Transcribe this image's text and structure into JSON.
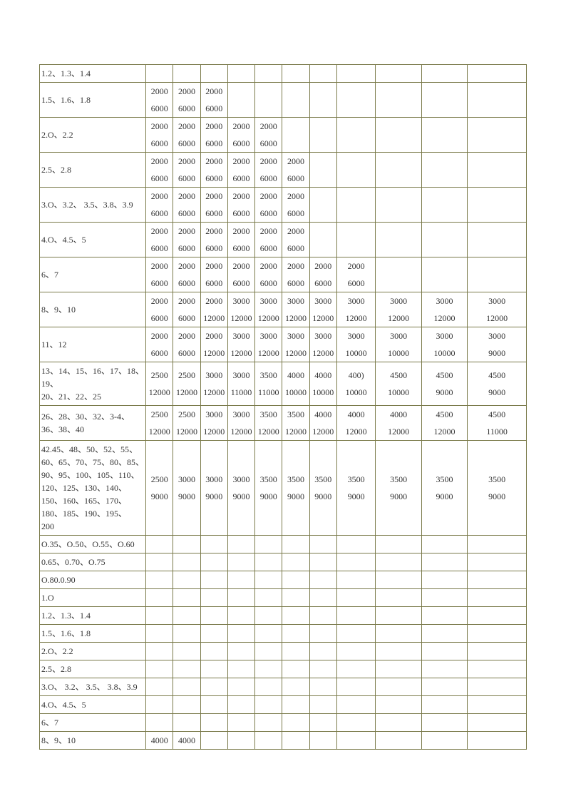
{
  "rows": [
    {
      "label": "1.2、1.3、1.4",
      "top": [
        "",
        "",
        "",
        "",
        "",
        "",
        "",
        "",
        "",
        "",
        ""
      ],
      "bot": [
        "",
        "",
        "",
        "",
        "",
        "",
        "",
        "",
        "",
        "",
        ""
      ],
      "single": true
    },
    {
      "label": "1.5、1.6、1.8",
      "top": [
        "2000",
        "2000",
        "2000",
        "",
        "",
        "",
        "",
        "",
        "",
        "",
        ""
      ],
      "bot": [
        "6000",
        "6000",
        "6000",
        "",
        "",
        "",
        "",
        "",
        "",
        "",
        ""
      ]
    },
    {
      "label": "2.O、2.2",
      "top": [
        "2000",
        "2000",
        "2000",
        "2000",
        "2000",
        "",
        "",
        "",
        "",
        "",
        ""
      ],
      "bot": [
        "6000",
        "6000",
        "6000",
        "6000",
        "6000",
        "",
        "",
        "",
        "",
        "",
        ""
      ]
    },
    {
      "label": "2.5、2.8",
      "top": [
        "2000",
        "2000",
        "2000",
        "2000",
        "2000",
        "2000",
        "",
        "",
        "",
        "",
        ""
      ],
      "bot": [
        "6000",
        "6000",
        "6000",
        "6000",
        "6000",
        "6000",
        "",
        "",
        "",
        "",
        ""
      ]
    },
    {
      "label": "3.O、3.2、 3.5、3.8、3.9",
      "top": [
        "2000",
        "2000",
        "2000",
        "2000",
        "2000",
        "2000",
        "",
        "",
        "",
        "",
        ""
      ],
      "bot": [
        "6000",
        "6000",
        "6000",
        "6000",
        "6000",
        "6000",
        "",
        "",
        "",
        "",
        ""
      ]
    },
    {
      "label": "4.O、4.5、5",
      "top": [
        "2000",
        "2000",
        "2000",
        "2000",
        "2000",
        "2000",
        "",
        "",
        "",
        "",
        ""
      ],
      "bot": [
        "6000",
        "6000",
        "6000",
        "6000",
        "6000",
        "6000",
        "",
        "",
        "",
        "",
        ""
      ]
    },
    {
      "label": "6、7",
      "top": [
        "2000",
        "2000",
        "2000",
        "2000",
        "2000",
        "2000",
        "2000",
        "2000",
        "",
        "",
        ""
      ],
      "bot": [
        "6000",
        "6000",
        "6000",
        "6000",
        "6000",
        "6000",
        "6000",
        "6000",
        "",
        "",
        ""
      ]
    },
    {
      "label": "8、9、10",
      "top": [
        "2000",
        "2000",
        "2000",
        "3000",
        "3000",
        "3000",
        "3000",
        "3000",
        "3000",
        "3000",
        "3000"
      ],
      "bot": [
        "6000",
        "6000",
        "12000",
        "12000",
        "12000",
        "12000",
        "12000",
        "12000",
        "12000",
        "12000",
        "12000"
      ]
    },
    {
      "label": "11、12",
      "top": [
        "2000",
        "2000",
        "2000",
        "3000",
        "3000",
        "3000",
        "3000",
        "3000",
        "3000",
        "3000",
        "3000"
      ],
      "bot": [
        "6000",
        "6000",
        "12000",
        "12000",
        "12000",
        "12000",
        "12000",
        "10000",
        "10000",
        "10000",
        "9000"
      ]
    },
    {
      "label": "13、14、15、16、17、18、19、\n20、21、22、25",
      "top": [
        "2500",
        "2500",
        "3000",
        "3000",
        "3500",
        "4000",
        "4000",
        "400)",
        "4500",
        "4500",
        "4500"
      ],
      "bot": [
        "12000",
        "12000",
        "12000",
        "11000",
        "11000",
        "10000",
        "10000",
        "10000",
        "10000",
        "9000",
        "9000"
      ]
    },
    {
      "label": "26、28、30、32、3-4、36、38、40",
      "top": [
        "2500",
        "2500",
        "3000",
        "3000",
        "3500",
        "3500",
        "4000",
        "4000",
        "4000",
        "4500",
        "4500"
      ],
      "bot": [
        "12000",
        "12000",
        "12000",
        "12000",
        "12000",
        "12000",
        "12000",
        "12000",
        "12000",
        "12000",
        "11000"
      ]
    },
    {
      "label": "42.45、48、50、52、55、60、65、70、75、80、85、90、95、100、105、110、120、125、130、140、150、160、165、170、180、185、190、195、\n200",
      "top": [
        "2500",
        "3000",
        "3000",
        "3000",
        "3500",
        "3500",
        "3500",
        "3500",
        "3500",
        "3500",
        "3500"
      ],
      "bot": [
        "9000",
        "9000",
        "9000",
        "9000",
        "9000",
        "9000",
        "9000",
        "9000",
        "9000",
        "9000",
        "9000"
      ]
    },
    {
      "label": "O.35、O.50、O.55、O.60",
      "top": [
        "",
        "",
        "",
        "",
        "",
        "",
        "",
        "",
        "",
        "",
        ""
      ],
      "bot": [
        "",
        "",
        "",
        "",
        "",
        "",
        "",
        "",
        "",
        "",
        ""
      ],
      "single": true
    },
    {
      "label": "0.65、0.70、O.75",
      "top": [
        "",
        "",
        "",
        "",
        "",
        "",
        "",
        "",
        "",
        "",
        ""
      ],
      "bot": [
        "",
        "",
        "",
        "",
        "",
        "",
        "",
        "",
        "",
        "",
        ""
      ],
      "single": true
    },
    {
      "label": "O.80.0.90",
      "top": [
        "",
        "",
        "",
        "",
        "",
        "",
        "",
        "",
        "",
        "",
        ""
      ],
      "bot": [
        "",
        "",
        "",
        "",
        "",
        "",
        "",
        "",
        "",
        "",
        ""
      ],
      "single": true
    },
    {
      "label": "1.O",
      "top": [
        "",
        "",
        "",
        "",
        "",
        "",
        "",
        "",
        "",
        "",
        ""
      ],
      "bot": [
        "",
        "",
        "",
        "",
        "",
        "",
        "",
        "",
        "",
        "",
        ""
      ],
      "single": true
    },
    {
      "label": "1.2、1.3、1.4",
      "top": [
        "",
        "",
        "",
        "",
        "",
        "",
        "",
        "",
        "",
        "",
        ""
      ],
      "bot": [
        "",
        "",
        "",
        "",
        "",
        "",
        "",
        "",
        "",
        "",
        ""
      ],
      "single": true
    },
    {
      "label": "1.5、1.6、1.8",
      "top": [
        "",
        "",
        "",
        "",
        "",
        "",
        "",
        "",
        "",
        "",
        ""
      ],
      "bot": [
        "",
        "",
        "",
        "",
        "",
        "",
        "",
        "",
        "",
        "",
        ""
      ],
      "single": true
    },
    {
      "label": "2.O、2.2",
      "top": [
        "",
        "",
        "",
        "",
        "",
        "",
        "",
        "",
        "",
        "",
        ""
      ],
      "bot": [
        "",
        "",
        "",
        "",
        "",
        "",
        "",
        "",
        "",
        "",
        ""
      ],
      "single": true
    },
    {
      "label": "2.5、2.8",
      "top": [
        "",
        "",
        "",
        "",
        "",
        "",
        "",
        "",
        "",
        "",
        ""
      ],
      "bot": [
        "",
        "",
        "",
        "",
        "",
        "",
        "",
        "",
        "",
        "",
        ""
      ],
      "single": true
    },
    {
      "label": "3.O、 3.2、 3.5、 3.8、3.9",
      "top": [
        "",
        "",
        "",
        "",
        "",
        "",
        "",
        "",
        "",
        "",
        ""
      ],
      "bot": [
        "",
        "",
        "",
        "",
        "",
        "",
        "",
        "",
        "",
        "",
        ""
      ],
      "single": true
    },
    {
      "label": "4.O、4.5、5",
      "top": [
        "",
        "",
        "",
        "",
        "",
        "",
        "",
        "",
        "",
        "",
        ""
      ],
      "bot": [
        "",
        "",
        "",
        "",
        "",
        "",
        "",
        "",
        "",
        "",
        ""
      ],
      "single": true
    },
    {
      "label": "6、7",
      "top": [
        "",
        "",
        "",
        "",
        "",
        "",
        "",
        "",
        "",
        "",
        ""
      ],
      "bot": [
        "",
        "",
        "",
        "",
        "",
        "",
        "",
        "",
        "",
        "",
        ""
      ],
      "single": true
    },
    {
      "label": "8、9、10",
      "top": [
        "4000",
        "4000",
        "",
        "",
        "",
        "",
        "",
        "",
        "",
        "",
        ""
      ],
      "bot": [
        "",
        "",
        "",
        "",
        "",
        "",
        "",
        "",
        "",
        "",
        ""
      ],
      "single": true
    }
  ]
}
